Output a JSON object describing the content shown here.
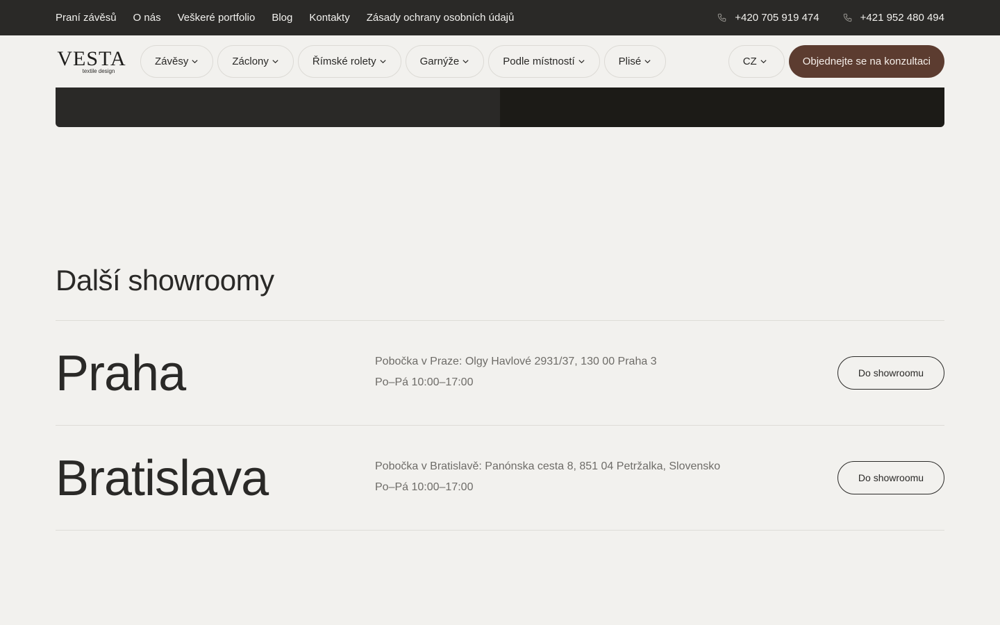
{
  "topbar": {
    "links": [
      "Praní závěsů",
      "O nás",
      "Veškeré portfolio",
      "Blog",
      "Kontakty",
      "Zásady ochrany osobních údajů"
    ],
    "phones": [
      "+420 705 919 474",
      "+421 952 480 494"
    ]
  },
  "nav": {
    "logo_word": "VESTA",
    "logo_sub": "textile design",
    "menu": [
      "Závěsy",
      "Záclony",
      "Římské rolety",
      "Garnýže",
      "Podle místností",
      "Plisé"
    ],
    "lang": "CZ",
    "cta": "Objednejte se na konzultaci"
  },
  "colors": {
    "topbar": "#2a2927",
    "accent": "#5c3c30",
    "background": "#f2f1ee"
  },
  "section": {
    "title": "Další showroomy",
    "showrooms": [
      {
        "city": "Praha",
        "address": "Pobočka v Praze: Olgy Havlové 2931/37, 130 00 Praha 3",
        "hours": "Po–Pá 10:00–17:00",
        "button": "Do showroomu"
      },
      {
        "city": "Bratislava",
        "address": "Pobočka v Bratislavě: Panónska cesta 8, 851 04 Petržalka, Slovensko",
        "hours": "Po–Pá 10:00–17:00",
        "button": "Do showroomu"
      }
    ]
  }
}
